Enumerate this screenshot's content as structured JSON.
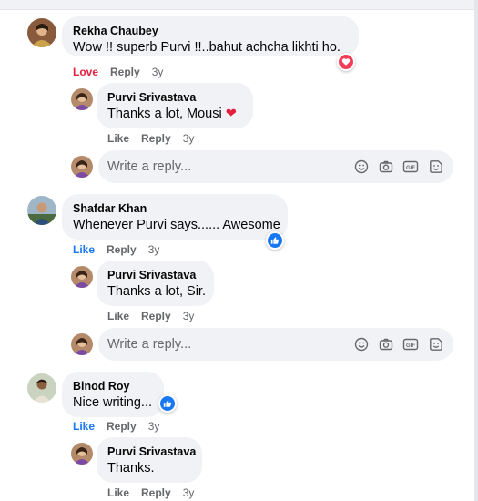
{
  "threads": [
    {
      "author": "Rekha Chaubey",
      "text": "Wow !! superb Purvi !!..bahut achcha likhti ho.",
      "reaction": "Love",
      "reply_label": "Reply",
      "time": "3y",
      "reaction_icon": "love-reaction-icon",
      "replies": [
        {
          "author": "Purvi Srivastava",
          "text": "Thanks a lot, Mousi",
          "emoji": "❤️",
          "like_label": "Like",
          "reply_label": "Reply",
          "time": "3y"
        }
      ]
    },
    {
      "author": "Shafdar Khan",
      "text": "Whenever Purvi says...... Awesome",
      "reaction": "Like",
      "reply_label": "Reply",
      "time": "3y",
      "reaction_icon": "like-reaction-icon",
      "replies": [
        {
          "author": "Purvi Srivastava",
          "text": "Thanks a lot, Sir.",
          "like_label": "Like",
          "reply_label": "Reply",
          "time": "3y"
        }
      ]
    },
    {
      "author": "Binod Roy",
      "text": "Nice writing...",
      "reaction": "Like",
      "reply_label": "Reply",
      "time": "3y",
      "reaction_icon": "like-reaction-icon",
      "replies": [
        {
          "author": "Purvi Srivastava",
          "text": "Thanks.",
          "like_label": "Like",
          "reply_label": "Reply",
          "time": "3y"
        }
      ]
    }
  ],
  "reply_box": {
    "placeholder": "Write a reply...",
    "icons": [
      "emoji-icon",
      "camera-icon",
      "gif-icon",
      "sticker-icon"
    ],
    "gif_label": "GIF"
  },
  "colors": {
    "bubble": "#f0f2f5",
    "meta": "#65676b",
    "love": "#e41e3f",
    "like": "#1877f2"
  }
}
